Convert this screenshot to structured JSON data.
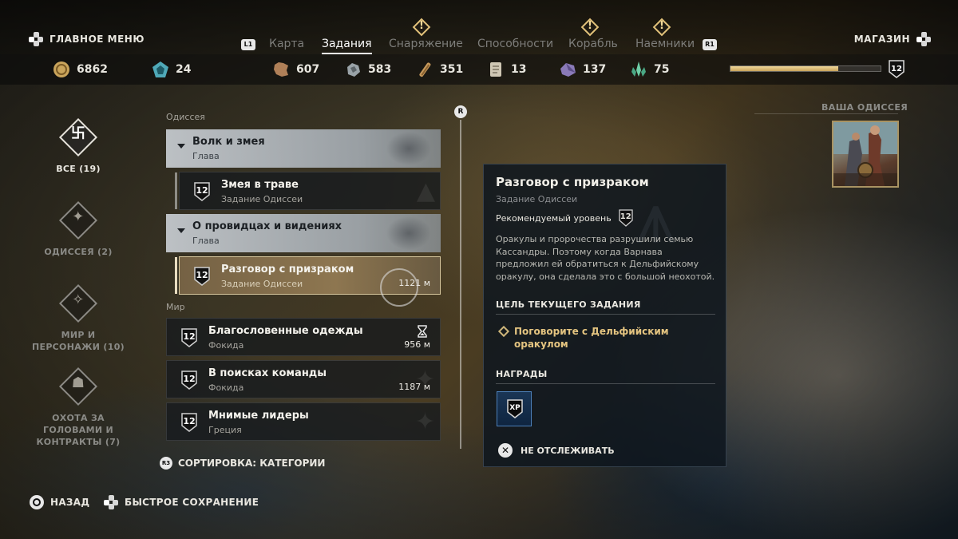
{
  "header": {
    "main_menu_label": "ГЛАВНОЕ МЕНЮ",
    "store_label": "МАГАЗИН",
    "left_bumper": "L1",
    "right_bumper": "R1",
    "tabs": [
      {
        "label": "Карта",
        "active": false,
        "alert": false
      },
      {
        "label": "Задания",
        "active": true,
        "alert": false
      },
      {
        "label": "Снаряжение",
        "active": false,
        "alert": true
      },
      {
        "label": "Способности",
        "active": false,
        "alert": false
      },
      {
        "label": "Корабль",
        "active": false,
        "alert": true
      },
      {
        "label": "Наемники",
        "active": false,
        "alert": true
      }
    ],
    "alert_glyph": "!"
  },
  "resources": [
    {
      "icon": "drachma-coin-icon",
      "value": "6862"
    },
    {
      "icon": "orichalcum-icon",
      "value": "24"
    },
    {
      "icon": "leather-icon",
      "value": "607"
    },
    {
      "icon": "iron-ore-icon",
      "value": "583"
    },
    {
      "icon": "wood-icon",
      "value": "351"
    },
    {
      "icon": "ancient-tablet-icon",
      "value": "13"
    },
    {
      "icon": "obsidian-icon",
      "value": "137"
    },
    {
      "icon": "crystal-icon",
      "value": "75"
    }
  ],
  "level": {
    "value": "12",
    "xp_progress": 0.72
  },
  "categories": [
    {
      "label": "ВСЕ (19)",
      "active": true,
      "glyph": "卐"
    },
    {
      "label": "ОДИССЕЯ (2)",
      "active": false,
      "glyph": "✦"
    },
    {
      "label": "МИР И ПЕРСОНАЖИ (10)",
      "active": false,
      "glyph": "✧"
    },
    {
      "label": "ОХОТА ЗА ГОЛОВАМИ И КОНТРАКТЫ (7)",
      "active": false,
      "glyph": "☗"
    }
  ],
  "quest_list": {
    "odyssey_label": "Одиссея",
    "world_label": "Мир",
    "chapter1": {
      "title": "Волк и змея",
      "sub": "Глава"
    },
    "quest1": {
      "level": "12",
      "title": "Змея в траве",
      "sub": "Задание Одиссеи"
    },
    "chapter2": {
      "title": "О провидцах и видениях",
      "sub": "Глава"
    },
    "quest2": {
      "level": "12",
      "title": "Разговор с призраком",
      "sub": "Задание Одиссеи",
      "distance": "1121 м"
    },
    "world1": {
      "level": "12",
      "title": "Благословенные одежды",
      "sub": "Фокида",
      "distance": "956 м",
      "icon": "hourglass-icon"
    },
    "world2": {
      "level": "12",
      "title": "В поисках команды",
      "sub": "Фокида",
      "distance": "1187 м"
    },
    "world3": {
      "level": "12",
      "title": "Мнимые лидеры",
      "sub": "Греция"
    }
  },
  "scroll_button": "R",
  "sort": {
    "button": "R3",
    "label": "СОРТИРОВКА: КАТЕГОРИИ"
  },
  "detail": {
    "title": "Разговор с призраком",
    "type": "Задание Одиссеи",
    "rec_label": "Рекомендуемый уровень",
    "rec_level": "12",
    "description": "Оракулы и пророчества разрушили семью Кассандры. Поэтому когда Варнава предложил ей обратиться к Дельфийскому оракулу, она сделала это с большой неохотой.",
    "objective_header": "ЦЕЛЬ ТЕКУЩЕГО ЗАДАНИЯ",
    "objective": "Поговорите с Дельфийским оракулом",
    "rewards_header": "НАГРАДЫ",
    "reward_xp": "XP",
    "untrack_button": "✕",
    "untrack": "НЕ ОТСЛЕЖИВАТЬ"
  },
  "odyssey_panel": {
    "label": "ВАША ОДИССЕЯ"
  },
  "footer": {
    "back": "НАЗАД",
    "quicksave": "БЫСТРОЕ СОХРАНЕНИЕ"
  },
  "colors": {
    "accent_gold": "#e4c480",
    "selected_row": "#8a7450",
    "panel": "#0e161e"
  }
}
